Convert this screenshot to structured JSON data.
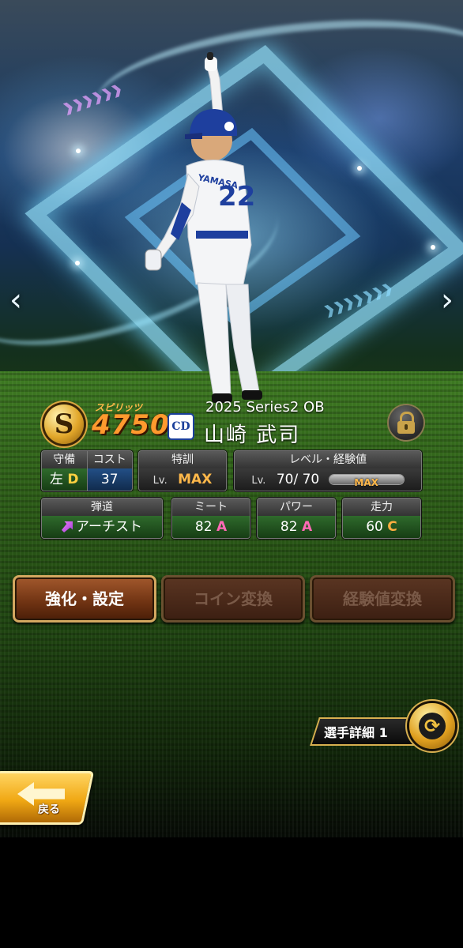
{
  "player": {
    "series": "2025 Series2 OB",
    "name": "山崎 武司",
    "jersey_number": "22",
    "uniform_name": "YAMASA",
    "rank": "S",
    "spirits_label": "スピリッツ",
    "spirits": "4750",
    "team_logo": "CD"
  },
  "stats": {
    "position": {
      "label": "守備",
      "hand": "左",
      "grade": "D"
    },
    "cost": {
      "label": "コスト",
      "value": "37"
    },
    "training": {
      "label": "特訓",
      "lv": "Lv.",
      "value": "MAX"
    },
    "level": {
      "label": "レベル・経験値",
      "lv": "Lv.",
      "current": "70/",
      "max": "70",
      "bar_text": "MAX",
      "bar_fill": 1.0
    },
    "trajectory": {
      "label": "弾道",
      "value": "アーチスト"
    },
    "meet": {
      "label": "ミート",
      "value": "82",
      "grade": "A"
    },
    "power": {
      "label": "パワー",
      "value": "82",
      "grade": "A"
    },
    "speed": {
      "label": "走力",
      "value": "60",
      "grade": "C"
    }
  },
  "actions": {
    "enhance": "強化・設定",
    "coin_exchange": "コイン変換",
    "exp_exchange": "経験値変換"
  },
  "details": {
    "label": "選手詳細 1"
  },
  "nav": {
    "prev": "‹",
    "next": "›"
  },
  "back": {
    "label": "戻る"
  },
  "colors": {
    "spirits": "#ff9a2e",
    "grade_a": "#ff6ab6",
    "grade_c": "#ffae40",
    "grade_d": "#ffd040",
    "max": "#ffb84a",
    "button_active": "#6e3212",
    "button_gold": "#f0a814"
  }
}
